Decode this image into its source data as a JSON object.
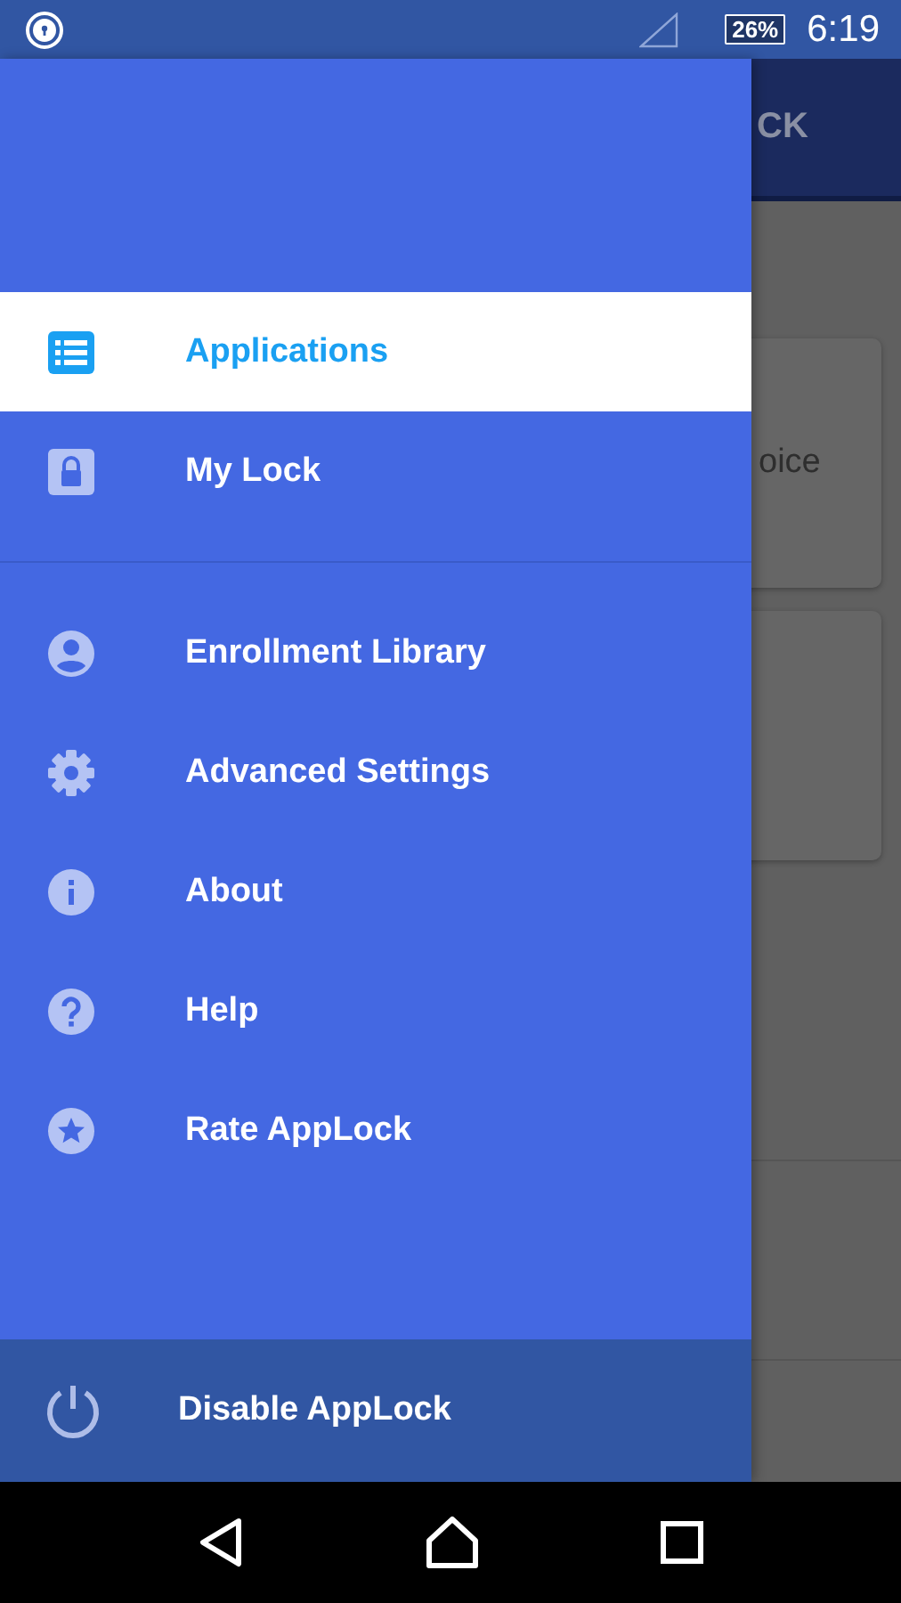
{
  "status_bar": {
    "battery": "26%",
    "time": "6:19"
  },
  "background": {
    "app_bar_title": "CK",
    "cards": [
      {
        "kind": "text",
        "text": "oice"
      },
      {
        "kind": "blank"
      }
    ]
  },
  "drawer": {
    "sections": [
      [
        {
          "label": "Applications",
          "selected": true
        },
        {
          "label": "My Lock",
          "selected": false
        }
      ],
      [
        {
          "label": "Enrollment Library",
          "selected": false
        },
        {
          "label": "Advanced Settings",
          "selected": false
        },
        {
          "label": "About",
          "selected": false
        },
        {
          "label": "Help",
          "selected": false
        },
        {
          "label": "Rate AppLock",
          "selected": false
        }
      ]
    ],
    "footer": {
      "label": "Disable AppLock"
    }
  }
}
